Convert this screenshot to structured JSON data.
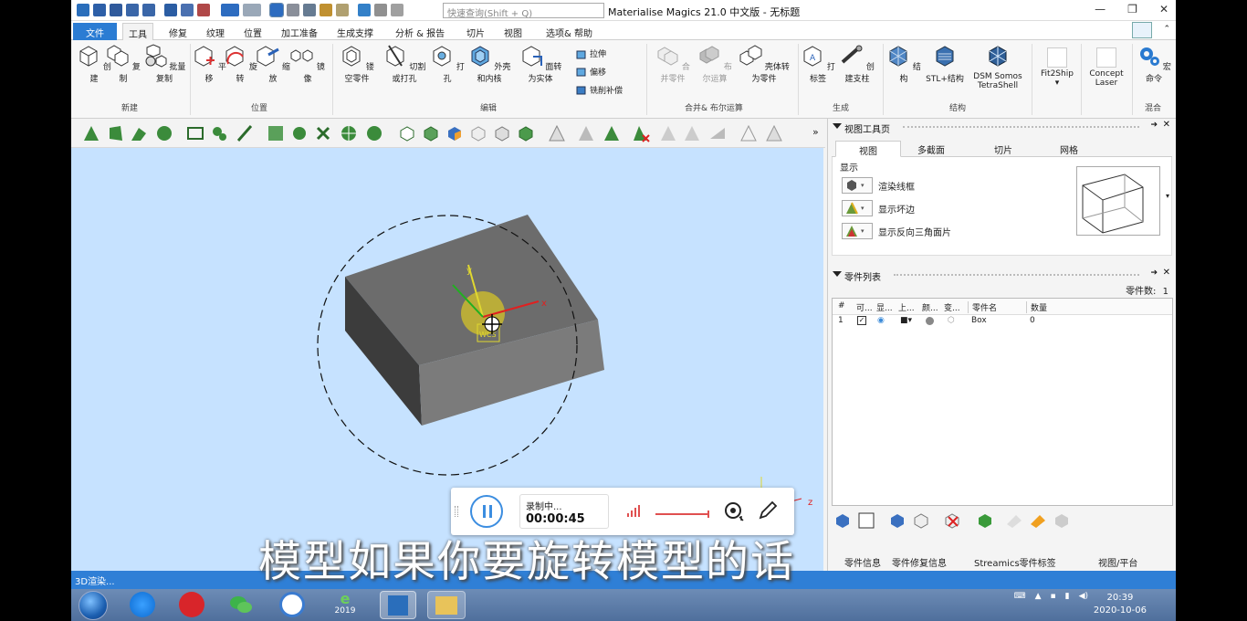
{
  "app": {
    "search_placeholder": "快速查询(Shift + Q)",
    "title": "Materialise Magics 21.0 中文版 - 无标题"
  },
  "menu": [
    "文件",
    "工具",
    "修复",
    "纹理",
    "位置",
    "加工准备",
    "生成支撑",
    "分析 & 报告",
    "切片",
    "视图",
    "选项& 帮助"
  ],
  "ribbon": {
    "buttons": {
      "create": "创建",
      "copy": "复制",
      "batch_copy": "批量复制",
      "translate": "平移",
      "rotate": "旋转",
      "scale": "缩放",
      "mirror": "镜像",
      "hollow": "镂空零件",
      "cut_punch": "切割或打孔",
      "punch": "打孔",
      "shell": "外壳和内核",
      "shell_to_solid": "面转为实体",
      "extrude": "拉伸",
      "offset": "偏移",
      "milling": "铣削补偿",
      "merge": "合并零件",
      "boolean": "布尔运算",
      "shell_to_parts": "壳体转为零件",
      "label": "打标签",
      "create_support": "创建支柱",
      "structure": "结构",
      "stl_structure": "STL+结构",
      "dsm_line1": "DSM Somos",
      "dsm_line2": "TetraShell",
      "fit2ship": "Fit2Ship",
      "concept": "Concept",
      "laser": "Laser",
      "macro": "宏命令"
    },
    "groups": {
      "new": "新建",
      "position": "位置",
      "edit": "编辑",
      "merge_boolean": "合并& 布尔运算",
      "generate": "生成",
      "structure": "结构",
      "mix": "混合"
    }
  },
  "viewport": {
    "axis_x": "x",
    "axis_y": "y",
    "axis_z": "z",
    "wcs": "WCS",
    "corner_z": "z"
  },
  "view_toolpage": {
    "title": "视图工具页",
    "tabs": [
      "视图",
      "多截面",
      "切片",
      "网格"
    ],
    "display_label": "显示",
    "rows": [
      "渲染线框",
      "显示坏边",
      "显示反向三角面片"
    ]
  },
  "parts_list": {
    "title": "零件列表",
    "count_label": "零件数:",
    "count": "1",
    "columns": [
      "#",
      "可...",
      "显...",
      "上...",
      "颜...",
      "变...",
      "零件名",
      "数量"
    ],
    "rows": [
      {
        "index": "1",
        "name": "Box",
        "qty": "0"
      }
    ]
  },
  "panel_footer": {
    "tabs": [
      "零件信息",
      "零件修复信息",
      "Streamics零件标签",
      "视图/平台"
    ]
  },
  "status": "3D渲染...",
  "recording": {
    "label": "录制中...",
    "time": "00:00:45"
  },
  "subtitle": "模型如果你要旋转模型的话",
  "taskbar": {
    "ie_year": "2019",
    "time": "20:39",
    "date": "2020-10-06"
  }
}
